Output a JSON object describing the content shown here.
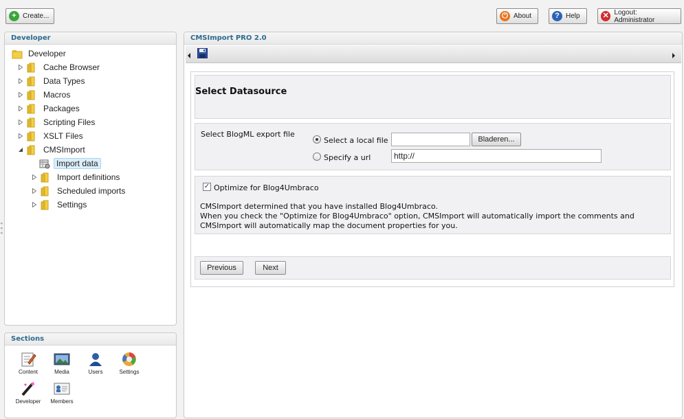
{
  "topbar": {
    "create_label": "Create...",
    "about_label": "About",
    "help_label": "Help",
    "logout_label": "Logout: Administrator"
  },
  "tree_panel": {
    "title": "Developer",
    "root": "Developer",
    "items": [
      "Cache Browser",
      "Data Types",
      "Macros",
      "Packages",
      "Scripting Files",
      "XSLT Files",
      "CMSImport"
    ],
    "cmsimport_children": [
      "Import data",
      "Import definitions",
      "Scheduled imports",
      "Settings"
    ],
    "selected": "Import data"
  },
  "sections_panel": {
    "title": "Sections",
    "items": [
      {
        "label": "Content",
        "icon": "content-icon"
      },
      {
        "label": "Media",
        "icon": "media-icon"
      },
      {
        "label": "Users",
        "icon": "users-icon"
      },
      {
        "label": "Settings",
        "icon": "settings-icon"
      },
      {
        "label": "Developer",
        "icon": "developer-icon"
      },
      {
        "label": "Members",
        "icon": "members-icon"
      }
    ]
  },
  "main": {
    "title": "CMSImport PRO 2.0",
    "heading": "Select Datasource",
    "export_label": "Select BlogML export file",
    "radio_local": "Select a local file",
    "browse_label": "Bladeren...",
    "radio_url": "Specify a url",
    "url_value": "http://",
    "optimize_label": "Optimize for Blog4Umbraco",
    "info_line1": "CMSImport determined that you have installed Blog4Umbraco.",
    "info_line2": "When you check the \"Optimize for Blog4Umbraco\" option, CMSImport will automatically import the comments and CMSImport will automatically map the document properties for you.",
    "previous_label": "Previous",
    "next_label": "Next"
  },
  "colors": {
    "panel_title": "#2b6a8f",
    "selection_bg": "#dbeefa"
  }
}
